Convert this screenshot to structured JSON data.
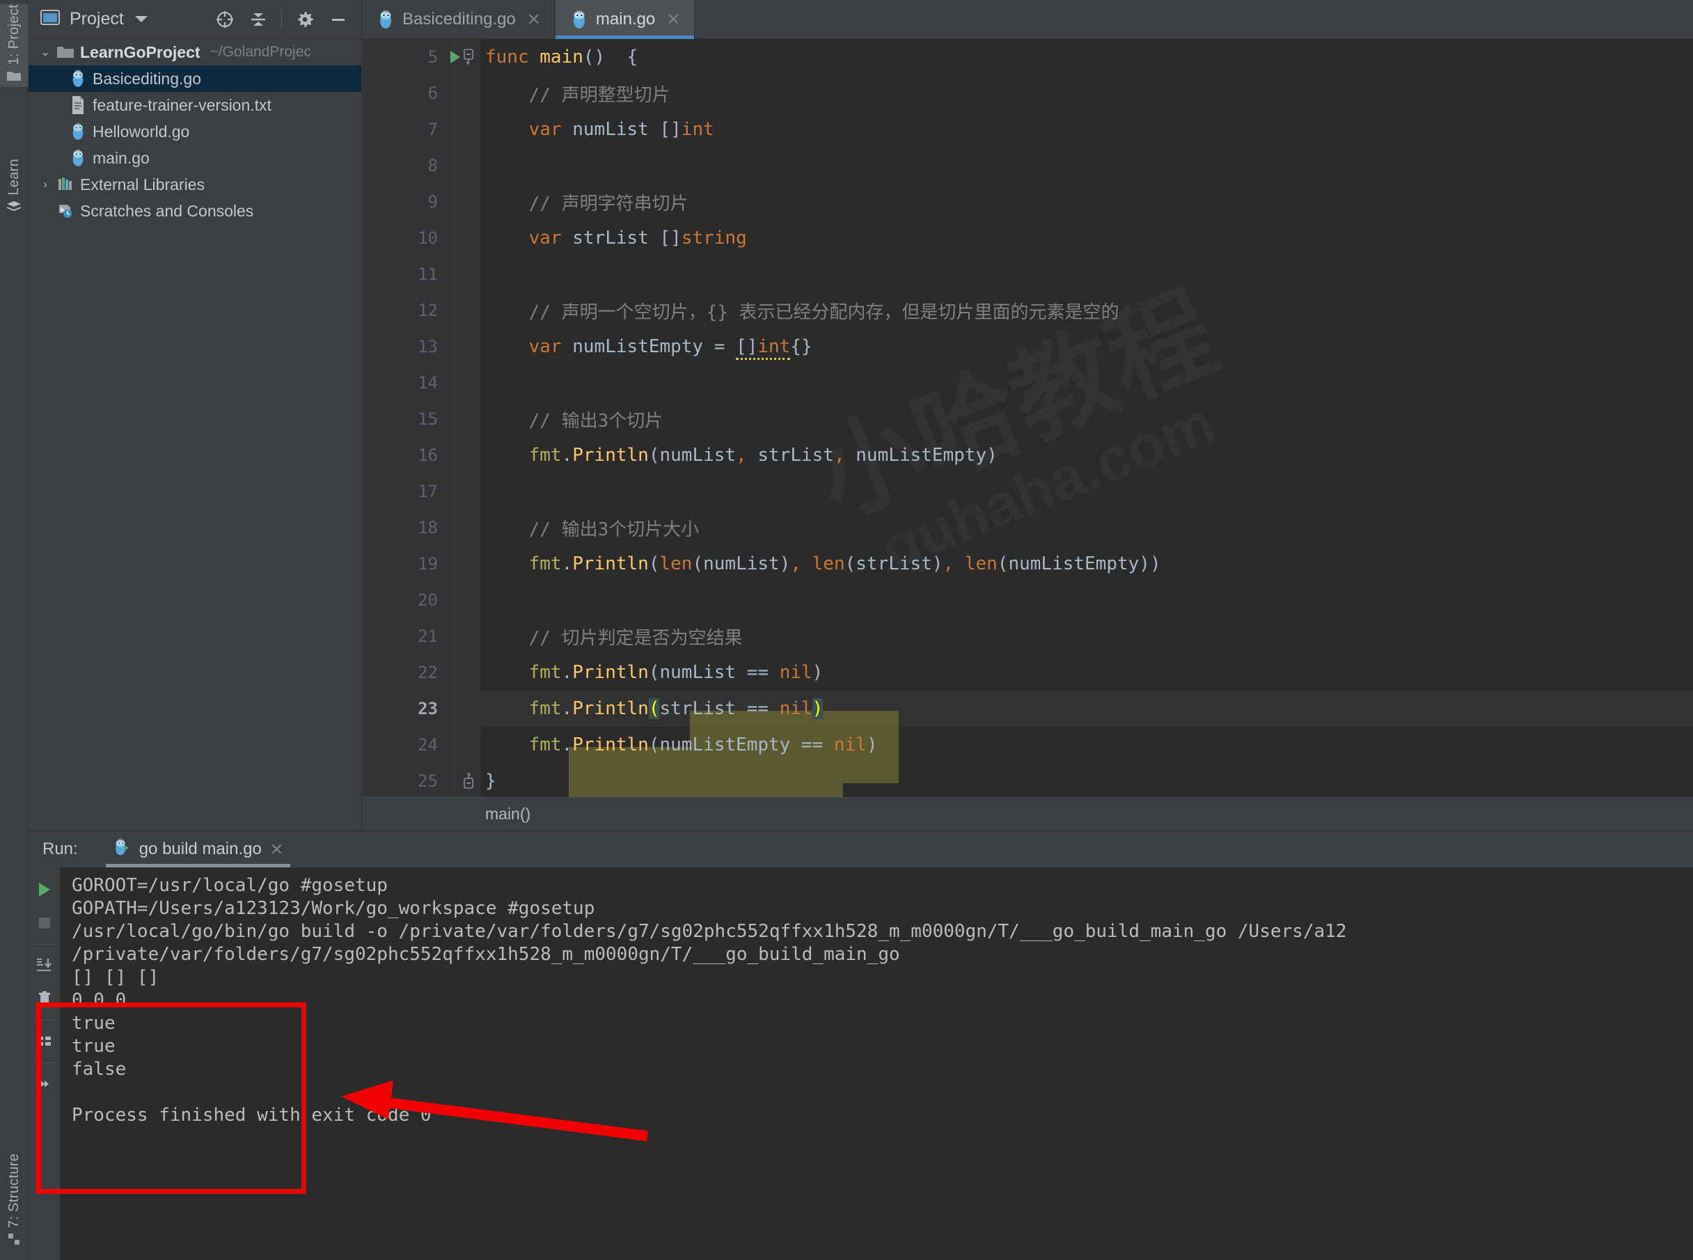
{
  "window": {
    "left_tool_tabs": [
      {
        "label": "1: Project",
        "icon": "project-folder-icon",
        "active": true
      },
      {
        "label": "Learn",
        "icon": "learn-book-icon",
        "active": false
      },
      {
        "label": "7: Structure",
        "icon": "structure-icon",
        "active": false
      }
    ]
  },
  "project_panel": {
    "title": "Project",
    "dropdown_icon": "chevron-down-icon",
    "toolbar": [
      {
        "name": "select-opened-file-icon",
        "label": "target-icon"
      },
      {
        "name": "collapse-all-icon",
        "label": "collapse-all"
      },
      {
        "name": "settings-gear-icon",
        "label": "gear"
      },
      {
        "name": "hide-panel-icon",
        "label": "minimize"
      }
    ],
    "tree": [
      {
        "label": "LearnGoProject",
        "path": "~/GolandProjec",
        "icon": "folder-icon",
        "arrow": "expanded",
        "depth": 0,
        "bold": true,
        "selected": false
      },
      {
        "label": "Basicediting.go",
        "path": "",
        "icon": "go-file-icon",
        "arrow": "none",
        "depth": 1,
        "bold": false,
        "selected": true
      },
      {
        "label": "feature-trainer-version.txt",
        "path": "",
        "icon": "text-file-icon",
        "arrow": "none",
        "depth": 1,
        "bold": false,
        "selected": false
      },
      {
        "label": "Helloworld.go",
        "path": "",
        "icon": "go-file-icon",
        "arrow": "none",
        "depth": 1,
        "bold": false,
        "selected": false
      },
      {
        "label": "main.go",
        "path": "",
        "icon": "go-file-icon",
        "arrow": "none",
        "depth": 1,
        "bold": false,
        "selected": false
      },
      {
        "label": "External Libraries",
        "path": "",
        "icon": "libraries-icon",
        "arrow": "collapsed",
        "depth": 0,
        "bold": false,
        "selected": false
      },
      {
        "label": "Scratches and Consoles",
        "path": "",
        "icon": "scratches-icon",
        "arrow": "none",
        "depth": 0,
        "bold": false,
        "selected": false
      }
    ]
  },
  "editor": {
    "tabs": [
      {
        "label": "Basicediting.go",
        "icon": "go-file-icon",
        "close_icon": "close-icon",
        "selected": false
      },
      {
        "label": "main.go",
        "icon": "go-file-icon",
        "close_icon": "close-icon",
        "selected": true
      }
    ],
    "breadcrumb": "main()",
    "current_line": 23,
    "lines": [
      {
        "n": "5",
        "text": "func main() {"
      },
      {
        "n": "6",
        "text": "    // 声明整型切片"
      },
      {
        "n": "7",
        "text": "    var numList []int"
      },
      {
        "n": "8",
        "text": ""
      },
      {
        "n": "9",
        "text": "    // 声明字符串切片"
      },
      {
        "n": "10",
        "text": "    var strList []string"
      },
      {
        "n": "11",
        "text": ""
      },
      {
        "n": "12",
        "text": "    // 声明一个空切片，{} 表示已经分配内存，但是切片里面的元素是空的"
      },
      {
        "n": "13",
        "text": "    var numListEmpty = []int{}"
      },
      {
        "n": "14",
        "text": ""
      },
      {
        "n": "15",
        "text": "    // 输出3个切片"
      },
      {
        "n": "16",
        "text": "    fmt.Println(numList, strList, numListEmpty)"
      },
      {
        "n": "17",
        "text": ""
      },
      {
        "n": "18",
        "text": "    // 输出3个切片大小"
      },
      {
        "n": "19",
        "text": "    fmt.Println(len(numList), len(strList), len(numListEmpty))"
      },
      {
        "n": "20",
        "text": ""
      },
      {
        "n": "21",
        "text": "    // 切片判定是否为空结果"
      },
      {
        "n": "22",
        "text": "    fmt.Println(numList == nil)"
      },
      {
        "n": "23",
        "text": "    fmt.Println(strList == nil)"
      },
      {
        "n": "24",
        "text": "    fmt.Println(numListEmpty == nil)"
      },
      {
        "n": "25",
        "text": "}"
      }
    ],
    "watermark_main": "小哈教程",
    "watermark_sub": "quhaha.com"
  },
  "run_panel": {
    "label": "Run:",
    "tab": {
      "label": "go build main.go",
      "icon": "go-run-icon",
      "close_icon": "close-icon"
    },
    "toolbar": [
      {
        "name": "rerun-play-icon"
      },
      {
        "name": "stop-icon"
      },
      {
        "name": "scroll-to-end-icon"
      },
      {
        "name": "trash-icon"
      },
      {
        "name": "soft-wrap-icon"
      },
      {
        "name": "print-arrows-icon"
      }
    ],
    "console_lines": [
      "GOROOT=/usr/local/go #gosetup",
      "GOPATH=/Users/a123123/Work/go_workspace #gosetup",
      "/usr/local/go/bin/go build -o /private/var/folders/g7/sg02phc552qffxx1h528_m_m0000gn/T/___go_build_main_go /Users/a12",
      "/private/var/folders/g7/sg02phc552qffxx1h528_m_m0000gn/T/___go_build_main_go",
      "[] [] []",
      "0 0 0",
      "true",
      "true",
      "false"
    ],
    "final_line": "Process finished with exit code 0"
  },
  "annotations": {
    "highlight_box_color": "#f00000",
    "arrow_color": "#f00000"
  },
  "colors": {
    "editor_bg": "#2b2b2b",
    "panel_bg": "#3c3f41",
    "accent_blue": "#4a88c7",
    "keyword_orange": "#cc7832",
    "function_yellow": "#ffc66d",
    "identifier": "#a9b7c6",
    "comment_gray": "#808080",
    "call_olive": "#b3ae60",
    "selection_olive": "#6d6b32"
  }
}
